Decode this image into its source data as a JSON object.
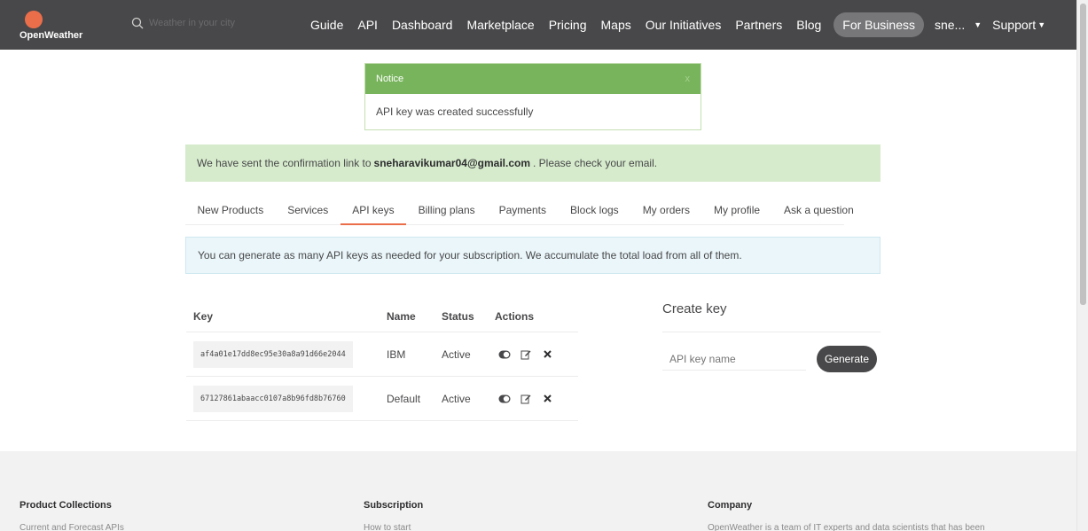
{
  "header": {
    "logo_text": "OpenWeather",
    "search_placeholder": "Weather in your city",
    "nav": [
      "Guide",
      "API",
      "Dashboard",
      "Marketplace",
      "Pricing",
      "Maps",
      "Our Initiatives",
      "Partners",
      "Blog"
    ],
    "business_label": "For Business",
    "user_label": "sne...",
    "support_label": "Support"
  },
  "notice": {
    "title": "Notice",
    "close_label": "x",
    "message": "API key was created successfully"
  },
  "confirmation": {
    "prefix": "We have sent the confirmation link to",
    "email": "sneharavikumar04@gmail.com",
    "suffix": ". Please check your email."
  },
  "tabs": [
    {
      "label": "New Products",
      "active": false
    },
    {
      "label": "Services",
      "active": false
    },
    {
      "label": "API keys",
      "active": true
    },
    {
      "label": "Billing plans",
      "active": false
    },
    {
      "label": "Payments",
      "active": false
    },
    {
      "label": "Block logs",
      "active": false
    },
    {
      "label": "My orders",
      "active": false
    },
    {
      "label": "My profile",
      "active": false
    },
    {
      "label": "Ask a question",
      "active": false
    }
  ],
  "info_text": "You can generate as many API keys as needed for your subscription. We accumulate the total load from all of them.",
  "keys_table": {
    "headers": {
      "key": "Key",
      "name": "Name",
      "status": "Status",
      "actions": "Actions"
    },
    "rows": [
      {
        "key": "af4a01e17dd8ec95e30a8a91d66e2044",
        "name": "IBM",
        "status": "Active"
      },
      {
        "key": "67127861abaacc0107a8b96fd8b76760",
        "name": "Default",
        "status": "Active"
      }
    ]
  },
  "create_key": {
    "title": "Create key",
    "input_placeholder": "API key name",
    "button_label": "Generate"
  },
  "footer": {
    "columns": [
      {
        "title": "Product Collections",
        "first_link": "Current and Forecast APIs"
      },
      {
        "title": "Subscription",
        "first_link": "How to start"
      },
      {
        "title": "Company",
        "first_link": "OpenWeather is a team of IT experts and data scientists that has been"
      }
    ]
  },
  "colors": {
    "navbar": "#48484a",
    "brand_orange": "#eb6e4b",
    "notice_green": "#78b45c",
    "confirm_bg": "#d6ebcc",
    "info_bg": "#eaf6fa"
  }
}
